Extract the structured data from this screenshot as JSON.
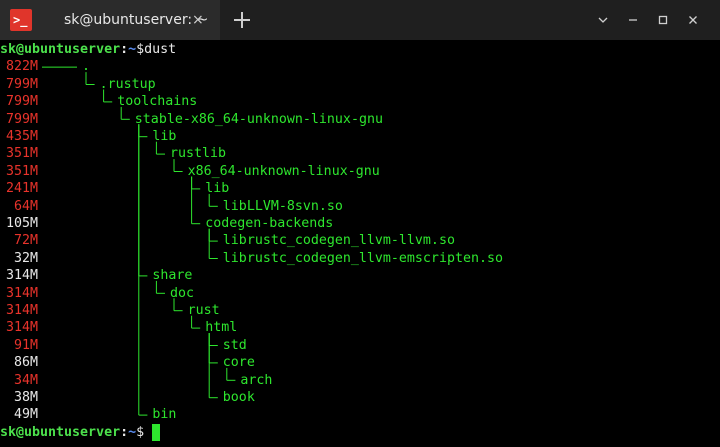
{
  "window": {
    "tab_title": "sk@ubuntuserver: ~",
    "tab_close": "×",
    "app_glyph": ">_"
  },
  "prompt": {
    "user_host": "sk@ubuntuserver",
    "sep": ":",
    "path": "~",
    "symbol": "$",
    "command": "dust"
  },
  "rows": [
    {
      "size": "822M",
      "name": ".",
      "depth": 0,
      "color": "red"
    },
    {
      "size": "799M",
      "name": ".rustup",
      "depth": 1,
      "color": "red"
    },
    {
      "size": "799M",
      "name": "toolchains",
      "depth": 2,
      "color": "red"
    },
    {
      "size": "799M",
      "name": "stable-x86_64-unknown-linux-gnu",
      "depth": 3,
      "color": "red"
    },
    {
      "size": "435M",
      "name": "lib",
      "depth": 4,
      "color": "red"
    },
    {
      "size": "351M",
      "name": "rustlib",
      "depth": 5,
      "color": "red"
    },
    {
      "size": "351M",
      "name": "x86_64-unknown-linux-gnu",
      "depth": 6,
      "color": "red"
    },
    {
      "size": "241M",
      "name": "lib",
      "depth": 7,
      "color": "red"
    },
    {
      "size": "64M",
      "name": "libLLVM-8svn.so",
      "depth": 8,
      "color": "red"
    },
    {
      "size": "105M",
      "name": "codegen-backends",
      "depth": 7,
      "color": "white"
    },
    {
      "size": "72M",
      "name": "librustc_codegen_llvm-llvm.so",
      "depth": 8,
      "color": "red"
    },
    {
      "size": "32M",
      "name": "librustc_codegen_llvm-emscripten.so",
      "depth": 8,
      "color": "white"
    },
    {
      "size": "314M",
      "name": "share",
      "depth": 4,
      "color": "white"
    },
    {
      "size": "314M",
      "name": "doc",
      "depth": 5,
      "color": "red"
    },
    {
      "size": "314M",
      "name": "rust",
      "depth": 6,
      "color": "red"
    },
    {
      "size": "314M",
      "name": "html",
      "depth": 7,
      "color": "red"
    },
    {
      "size": "91M",
      "name": "std",
      "depth": 8,
      "color": "red"
    },
    {
      "size": "86M",
      "name": "core",
      "depth": 8,
      "color": "white"
    },
    {
      "size": "34M",
      "name": "arch",
      "depth": 9,
      "color": "red"
    },
    {
      "size": "38M",
      "name": "book",
      "depth": 8,
      "color": "white"
    },
    {
      "size": "49M",
      "name": "bin",
      "depth": 4,
      "color": "white"
    }
  ],
  "colors": {
    "red": "#e8332b",
    "white": "#e8e8e8",
    "green": "#2ee62e"
  }
}
